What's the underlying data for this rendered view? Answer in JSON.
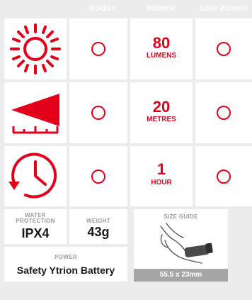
{
  "headers": {
    "boost": "BOOST",
    "power": "POWER",
    "low_power": "LOW POWER"
  },
  "rows": [
    {
      "icon": "sun-brightness-icon",
      "value": "80",
      "unit": "LUMENS"
    },
    {
      "icon": "beam-distance-icon",
      "value": "20",
      "unit": "METRES"
    },
    {
      "icon": "runtime-clock-icon",
      "value": "1",
      "unit": "HOUR"
    }
  ],
  "water": {
    "label_line1": "WATER",
    "label_line2": "PROTECTION",
    "value": "IPX4"
  },
  "weight": {
    "label": "WEIGHT",
    "value": "43g"
  },
  "power_spec": {
    "label": "POWER",
    "value": "Safety Ytrion Battery"
  },
  "size_guide": {
    "label": "SIZE GUIDE",
    "icon": "hand-holding-light-icon",
    "value": "55.5 x 23mm"
  },
  "colors": {
    "accent": "#e3001b",
    "background": "#ececec",
    "panel": "#ffffff",
    "muted": "#a6a6a6"
  }
}
